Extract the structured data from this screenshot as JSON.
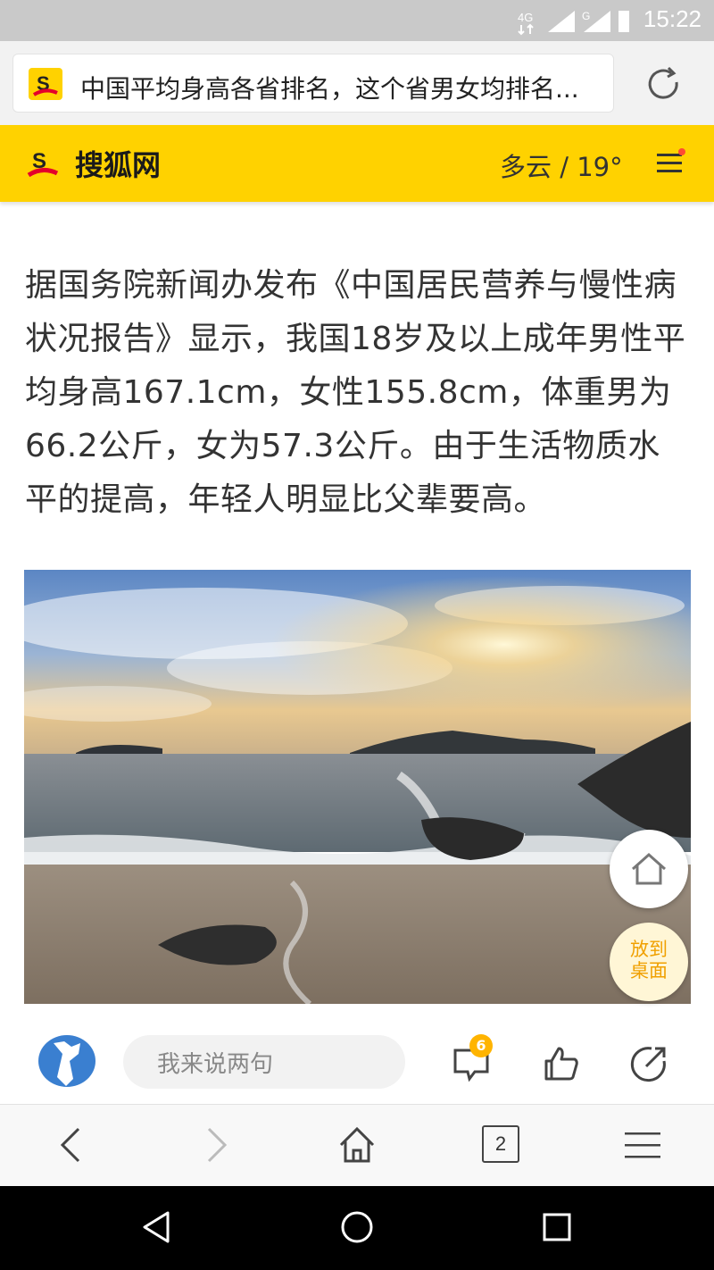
{
  "status_bar": {
    "network_label": "4G",
    "second_network_label": "G",
    "time": "15:22"
  },
  "address_bar": {
    "page_title": "中国平均身高各省排名，这个省男女均排名...",
    "site_icon": "sohu-logo-icon",
    "reload_icon": "reload-icon"
  },
  "site_header": {
    "site_name": "搜狐网",
    "weather": "多云 / 19°",
    "menu_icon": "menu-icon",
    "menu_notification_color": "#ff4b33",
    "header_color": "#ffd200"
  },
  "article": {
    "paragraph": "据国务院新闻办发布《中国居民营养与慢性病状况报告》显示，我国18岁及以上成年男性平均身高167.1cm，女性155.8cm，体重男为66.2公斤，女为57.3公斤。由于生活物质水平的提高，年轻人明显比父辈要高。"
  },
  "floating_buttons": {
    "home_icon": "home-outline-icon",
    "add_to_desktop_line1": "放到",
    "add_to_desktop_line2": "桌面"
  },
  "comment_bar": {
    "placeholder": "我来说两句",
    "comment_count": "6",
    "icons": [
      "avatar",
      "comment-icon",
      "like-icon",
      "share-icon"
    ]
  },
  "browser_toolbar": {
    "tab_count": "2",
    "icons": [
      "back-icon",
      "forward-icon",
      "home-icon",
      "tabs-icon",
      "menu-icon"
    ]
  },
  "android_nav": {
    "icons": [
      "back-triangle-icon",
      "home-circle-icon",
      "recents-square-icon"
    ]
  }
}
